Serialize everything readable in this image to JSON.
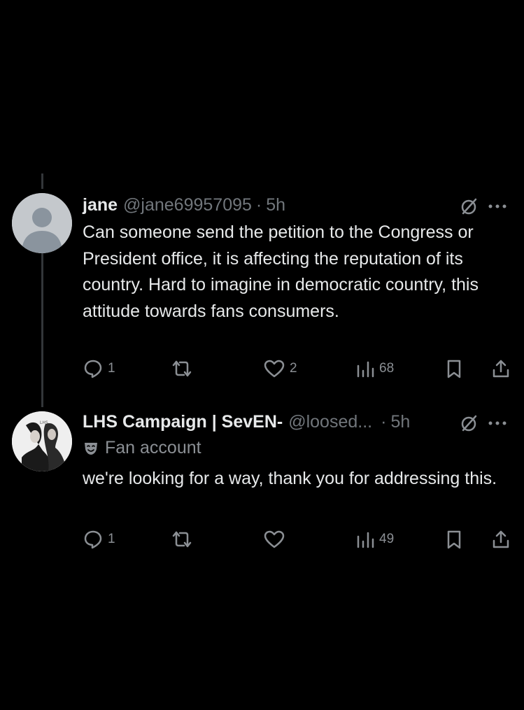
{
  "tweets": [
    {
      "name": "jane",
      "handle": "@jane69957095",
      "separator": "·",
      "time": "5h",
      "text": "Can someone send the petition to the Congress or President office, it is affecting the reputation of its country. Hard to imagine in democratic country, this attitude towards fans consumers.",
      "replies": "1",
      "likes": "2",
      "views": "68"
    },
    {
      "name": "LHS Campaign | SevEN-",
      "handle": "@loosed...",
      "separator": "·",
      "time": "5h",
      "label": "Fan account",
      "text": "we're looking for a way, thank you for addressing this.",
      "replies": "1",
      "views": "49"
    }
  ],
  "icons": {
    "grok": "slashed-circle-icon",
    "more": "more-horizontal-icon",
    "reply": "reply-icon",
    "retweet": "retweet-icon",
    "like": "heart-icon",
    "views": "views-icon",
    "bookmark": "bookmark-icon",
    "share": "share-icon",
    "label": "theater-masks-icon"
  },
  "colors": {
    "background": "#000000",
    "primary_text": "#e7e9ea",
    "secondary_text": "#71767b",
    "icon": "#8b8f94",
    "thread_line": "#333639"
  }
}
